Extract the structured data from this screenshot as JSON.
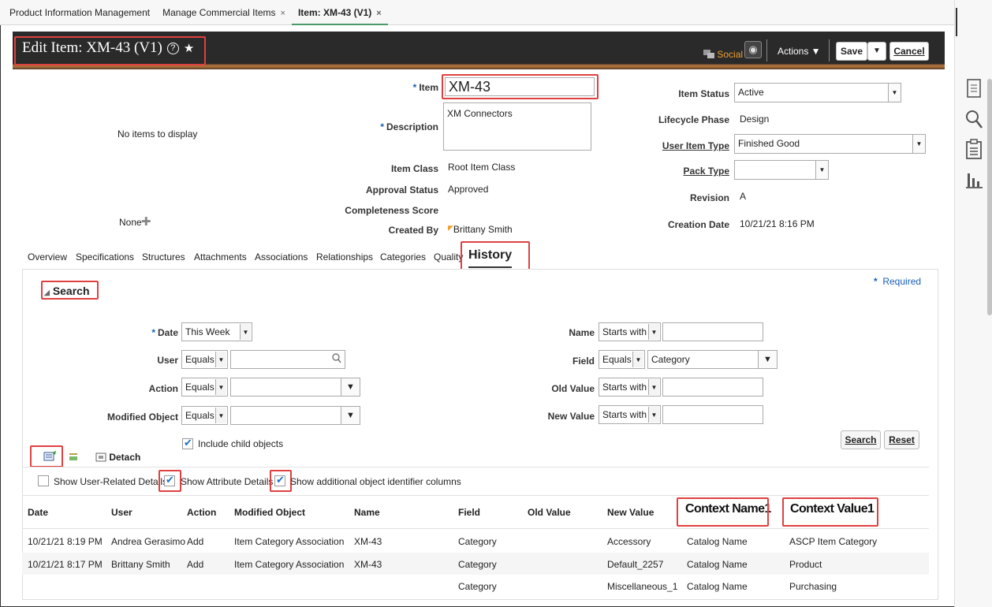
{
  "top_tabs": [
    {
      "label": "Product Information Management",
      "closable": false
    },
    {
      "label": "Manage Commercial Items",
      "closable": true
    },
    {
      "label": "Item: XM-43 (V1)",
      "closable": true,
      "active": true
    }
  ],
  "close_glyph": "×",
  "header": {
    "title": "Edit Item: XM-43 (V1)",
    "help": "?",
    "star": "★",
    "social": "Social",
    "actions": "Actions ▼",
    "save": "Save",
    "save_menu": "▼",
    "cancel": "Cancel"
  },
  "left_panel": {
    "empty_text": "No items to display",
    "none_text": "None",
    "add_glyph": "✚"
  },
  "item_form": {
    "item_label": "Item",
    "item_value": "XM-43",
    "description_label": "Description",
    "description_value": "XM Connectors",
    "item_class_label": "Item Class",
    "item_class_value": "Root Item Class",
    "approval_status_label": "Approval Status",
    "approval_status_value": "Approved",
    "completeness_label": "Completeness Score",
    "created_by_label": "Created By",
    "created_by_value": "Brittany Smith",
    "item_status_label": "Item Status",
    "item_status_value": "Active",
    "lifecycle_label": "Lifecycle Phase",
    "lifecycle_value": "Design",
    "user_item_type_label": "User Item Type",
    "user_item_type_value": "Finished Good",
    "pack_type_label": "Pack Type",
    "pack_type_value": "",
    "revision_label": "Revision",
    "revision_value": "A",
    "creation_date_label": "Creation Date",
    "creation_date_value": "10/21/21 8:16 PM",
    "required_mark": "*"
  },
  "page_tabs": [
    "Overview",
    "Specifications",
    "Structures",
    "Attachments",
    "Associations",
    "Relationships",
    "Categories",
    "Quality",
    "History"
  ],
  "search": {
    "title": "Search",
    "required_note": "Required",
    "date_label": "Date",
    "date_value": "This Week",
    "user_label": "User",
    "user_op": "Equals",
    "user_value": "",
    "action_label": "Action",
    "action_op": "Equals",
    "action_value": "",
    "modified_object_label": "Modified Object",
    "modified_object_op": "Equals",
    "modified_object_value": "",
    "name_label": "Name",
    "name_op": "Starts with",
    "name_value": "",
    "field_label": "Field",
    "field_op": "Equals",
    "field_value": "Category",
    "old_value_label": "Old Value",
    "old_value_op": "Starts with",
    "old_value_value": "",
    "new_value_label": "New Value",
    "new_value_op": "Starts with",
    "new_value_value": "",
    "include_child": "Include child objects",
    "search_button": "Search",
    "reset_button": "Reset"
  },
  "toolbar": {
    "detach": "Detach",
    "show_user_details": "Show User-Related Details",
    "show_attribute_details": "Show Attribute Details",
    "show_additional_columns": "Show additional object identifier columns"
  },
  "table": {
    "headers": [
      "Date",
      "User",
      "Action",
      "Modified Object",
      "Name",
      "Field",
      "Old Value",
      "New Value",
      "Context Name1",
      "Context Value1"
    ],
    "rows": [
      [
        "10/21/21 8:19 PM",
        "Andrea Gerasimo",
        "Add",
        "Item Category Association",
        "XM-43",
        "Category",
        "",
        "Accessory",
        "Catalog Name",
        "ASCP Item Category"
      ],
      [
        "10/21/21 8:17 PM",
        "Brittany Smith",
        "Add",
        "Item Category Association",
        "XM-43",
        "Category",
        "",
        "Default_2257",
        "Catalog Name",
        "Product"
      ],
      [
        "",
        "",
        "",
        "",
        "",
        "Category",
        "",
        "Miscellaneous_1",
        "Catalog Name",
        "Purchasing"
      ]
    ]
  },
  "colors": {
    "highlight": "#e04040",
    "header_bg": "#2a2a2a",
    "required": "#1a5fb4",
    "checkbox": "#1a6fc4"
  }
}
